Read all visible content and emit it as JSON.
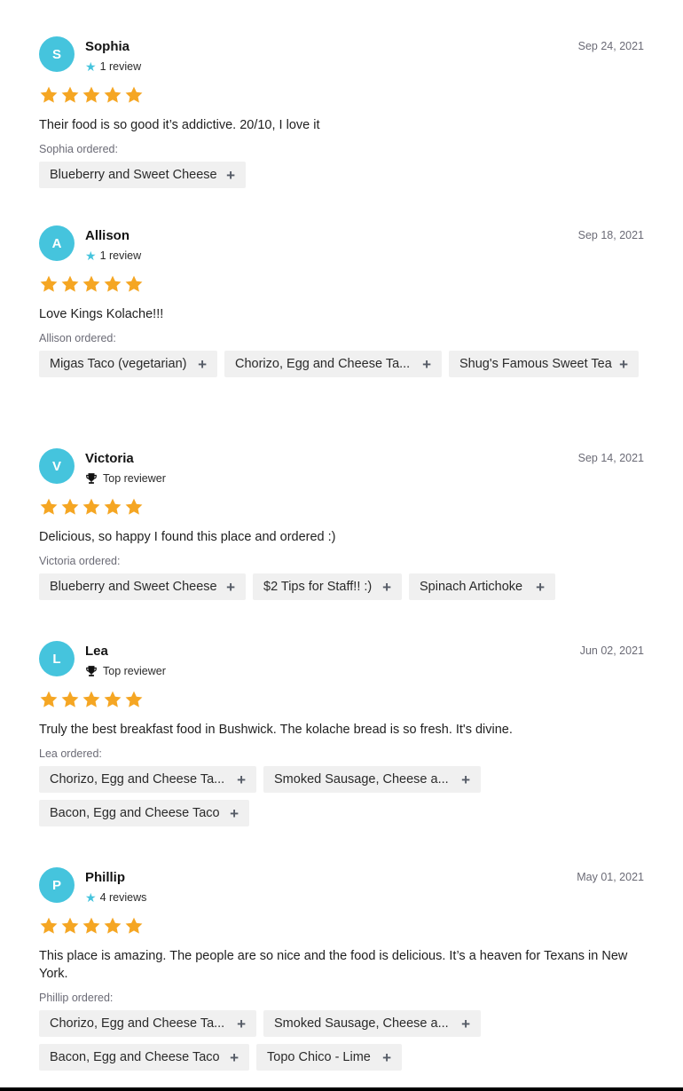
{
  "colors": {
    "avatar": "#45c4dd",
    "star": "#f5a623",
    "meta_star": "#45c4dd",
    "chip_bg": "#f0f0f0",
    "muted_text": "#6b6b76"
  },
  "reviews": [
    {
      "initial": "S",
      "name": "Sophia",
      "badge_icon": "star-icon",
      "meta": "1 review",
      "date": "Sep 24, 2021",
      "rating": 5,
      "text": "Their food is so good it’s addictive. 20/10, I love it",
      "ordered_label": "Sophia ordered:",
      "items": [
        "Blueberry and Sweet Cheese"
      ]
    },
    {
      "initial": "A",
      "name": "Allison",
      "badge_icon": "star-icon",
      "meta": "1 review",
      "date": "Sep 18, 2021",
      "rating": 5,
      "text": "Love Kings Kolache!!!",
      "ordered_label": "Allison ordered:",
      "items": [
        "Migas Taco (vegetarian)",
        "Chorizo, Egg and Cheese Ta...",
        "Shug's Famous Sweet Tea"
      ]
    },
    {
      "initial": "V",
      "name": "Victoria",
      "badge_icon": "trophy-icon",
      "meta": "Top reviewer",
      "date": "Sep 14, 2021",
      "rating": 5,
      "text": "Delicious, so happy I found this place and ordered :)",
      "ordered_label": "Victoria ordered:",
      "items": [
        "Blueberry and Sweet Cheese",
        "$2 Tips for Staff!! :)",
        "Spinach Artichoke"
      ]
    },
    {
      "initial": "L",
      "name": "Lea",
      "badge_icon": "trophy-icon",
      "meta": "Top reviewer",
      "date": "Jun 02, 2021",
      "rating": 5,
      "text": "Truly the best breakfast food in Bushwick. The kolache bread is so fresh. It's divine.",
      "ordered_label": "Lea ordered:",
      "items": [
        "Chorizo, Egg and Cheese Ta...",
        "Smoked Sausage, Cheese a...",
        "Bacon, Egg and Cheese Taco"
      ]
    },
    {
      "initial": "P",
      "name": "Phillip",
      "badge_icon": "star-icon",
      "meta": "4 reviews",
      "date": "May 01, 2021",
      "rating": 5,
      "text": "This place is amazing. The people are so nice and the food is delicious. It’s a heaven for Texans in New York.",
      "ordered_label": "Phillip ordered:",
      "items": [
        "Chorizo, Egg and Cheese Ta...",
        "Smoked Sausage, Cheese a...",
        "Bacon, Egg and Cheese Taco",
        "Topo Chico - Lime"
      ]
    }
  ]
}
